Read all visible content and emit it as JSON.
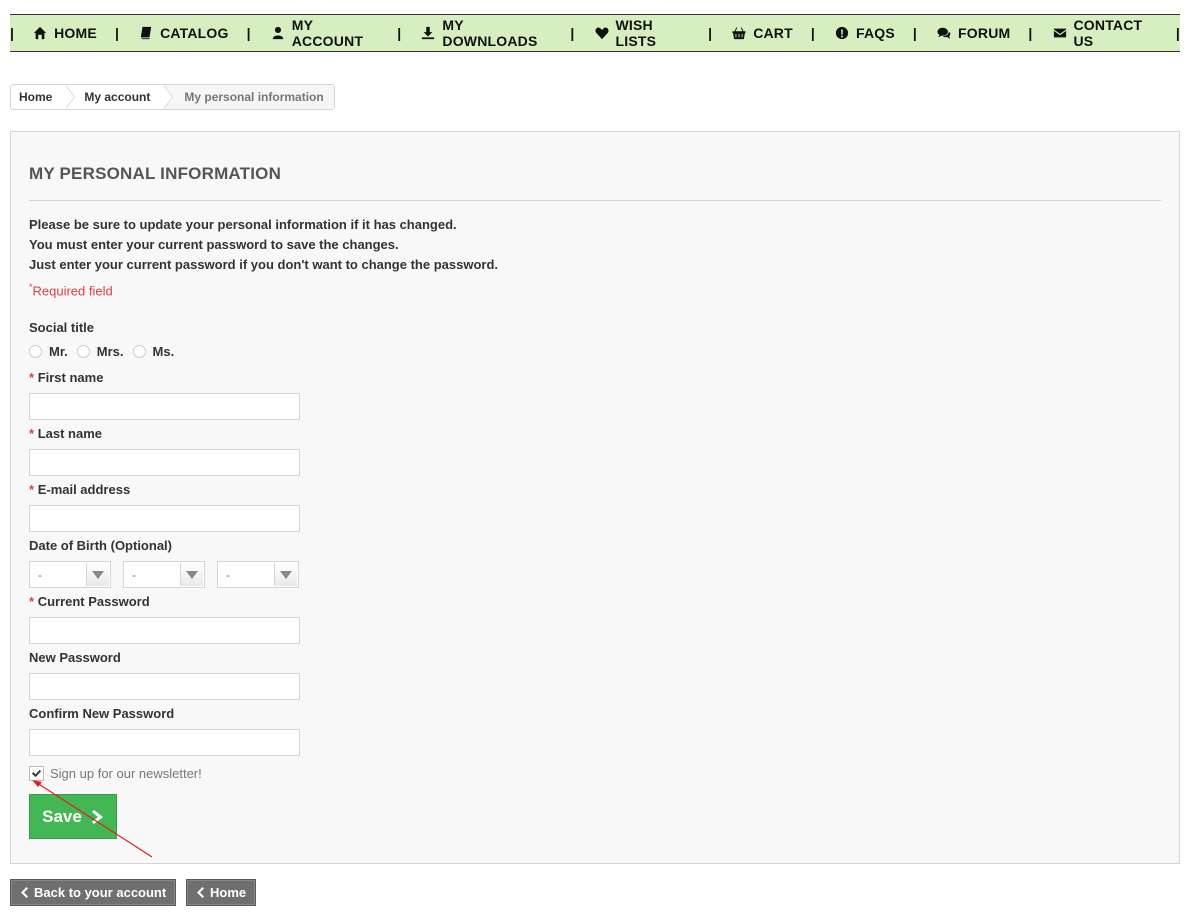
{
  "nav": {
    "items": [
      {
        "label": "HOME",
        "icon": "home-icon"
      },
      {
        "label": "CATALOG",
        "icon": "book-icon"
      },
      {
        "label": "MY ACCOUNT",
        "icon": "user-icon"
      },
      {
        "label": "MY DOWNLOADS",
        "icon": "download-icon"
      },
      {
        "label": "WISH LISTS",
        "icon": "heart-icon"
      },
      {
        "label": "CART",
        "icon": "basket-icon"
      },
      {
        "label": "FAQS",
        "icon": "exclamation-circle-icon"
      },
      {
        "label": "FORUM",
        "icon": "comments-icon"
      },
      {
        "label": "CONTACT US",
        "icon": "envelope-icon"
      }
    ],
    "background": "#d6eec0"
  },
  "breadcrumb": {
    "home": "Home",
    "account": "My account",
    "current": "My personal information"
  },
  "form": {
    "title": "MY PERSONAL INFORMATION",
    "intro": [
      "Please be sure to update your personal information if it has changed.",
      "You must enter your current password to save the changes.",
      "Just enter your current password if you don't want to change the password."
    ],
    "required_star": "*",
    "required_note": "Required field",
    "social_title_label": "Social title",
    "social_titles": [
      "Mr.",
      "Mrs.",
      "Ms."
    ],
    "first_name_label": "First name",
    "last_name_label": "Last name",
    "email_label": "E-mail address",
    "dob_label": "Date of Birth (Optional)",
    "dob_day": "-",
    "dob_month": "-",
    "dob_year": "-",
    "current_password_label": "Current Password",
    "new_password_label": "New Password",
    "confirm_password_label": "Confirm New Password",
    "newsletter_label": "Sign up for our newsletter!",
    "newsletter_checked": true,
    "save_label": "Save"
  },
  "footer": {
    "back_account_label": "Back to your account",
    "home_label": "Home"
  },
  "colors": {
    "accent_green": "#43b754",
    "required_red": "#e04040",
    "annotation_red": "#e02020"
  }
}
